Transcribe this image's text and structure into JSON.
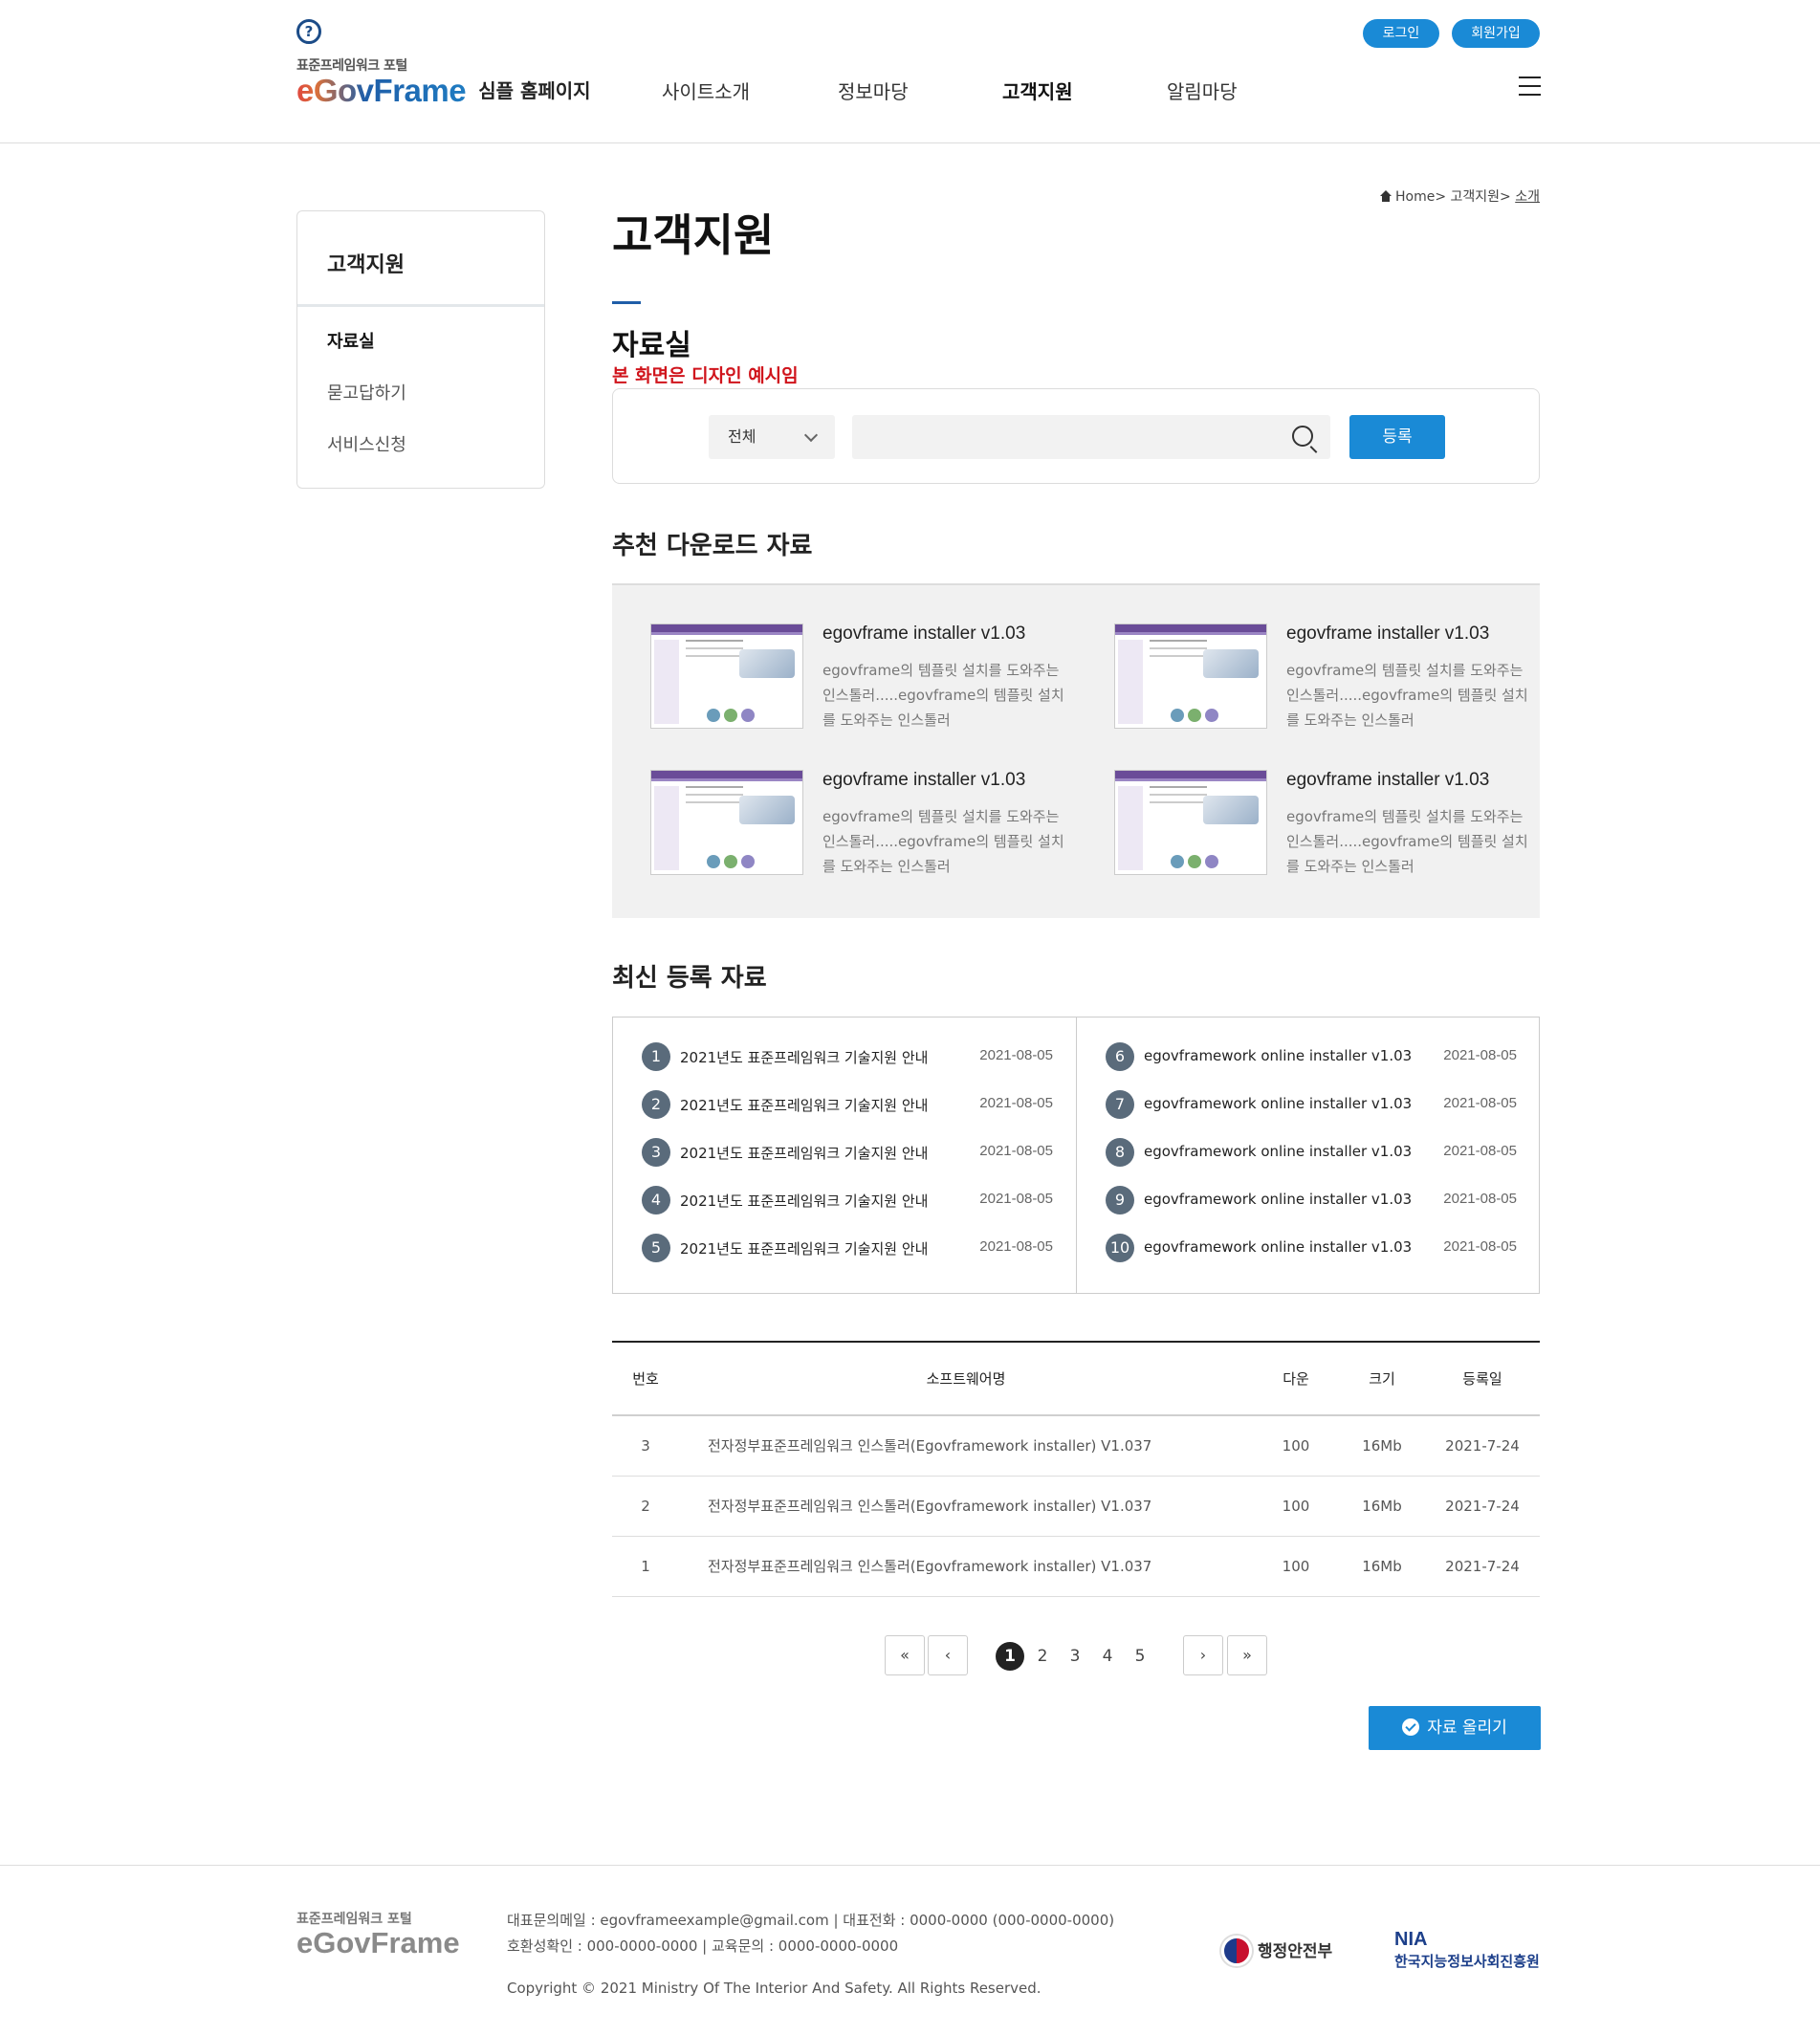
{
  "header": {
    "help_icon": "?",
    "logo_sub": "표준프레임워크 포털",
    "logo_main": "eGovFrame",
    "logo_tag": "심플 홈페이지",
    "nav": [
      "사이트소개",
      "정보마당",
      "고객지원",
      "알림마당"
    ],
    "nav_active": "고객지원",
    "login": "로그인",
    "signup": "회원가입"
  },
  "breadcrumb": {
    "home": "Home",
    "sep": ">",
    "level1": "고객지원",
    "level2": "소개"
  },
  "sidebar": {
    "title": "고객지원",
    "items": [
      {
        "label": "자료실",
        "active": true
      },
      {
        "label": "묻고답하기",
        "active": false
      },
      {
        "label": "서비스신청",
        "active": false
      }
    ]
  },
  "main": {
    "title": "고객지원",
    "subtitle": "자료실",
    "notice": "본 화면은 디자인 예시임"
  },
  "search": {
    "select_value": "전체",
    "input_value": "",
    "button": "등록"
  },
  "recommended": {
    "title": "추천 다운로드 자료",
    "items": [
      {
        "title": "egovframe installer v1.03",
        "desc": "egovframe의 템플릿 설치를 도와주는 인스톨러.....egovframe의 템플릿 설치를 도와주는 인스톨러"
      },
      {
        "title": "egovframe installer v1.03",
        "desc": "egovframe의 템플릿 설치를 도와주는 인스톨러.....egovframe의 템플릿 설치를 도와주는 인스톨러"
      },
      {
        "title": "egovframe installer v1.03",
        "desc": "egovframe의 템플릿 설치를 도와주는 인스톨러.....egovframe의 템플릿 설치를 도와주는 인스톨러"
      },
      {
        "title": "egovframe installer v1.03",
        "desc": "egovframe의 템플릿 설치를 도와주는 인스톨러.....egovframe의 템플릿 설치를 도와주는 인스톨러"
      }
    ]
  },
  "latest": {
    "title": "최신 등록 자료",
    "left": [
      {
        "no": "1",
        "title": "2021년도 표준프레임워크 기술지원 안내",
        "date": "2021-08-05"
      },
      {
        "no": "2",
        "title": "2021년도 표준프레임워크 기술지원 안내",
        "date": "2021-08-05"
      },
      {
        "no": "3",
        "title": "2021년도 표준프레임워크 기술지원 안내",
        "date": "2021-08-05"
      },
      {
        "no": "4",
        "title": "2021년도 표준프레임워크 기술지원 안내",
        "date": "2021-08-05"
      },
      {
        "no": "5",
        "title": "2021년도 표준프레임워크 기술지원 안내",
        "date": "2021-08-05"
      }
    ],
    "right": [
      {
        "no": "6",
        "title": "egovframework online installer v1.03",
        "date": "2021-08-05"
      },
      {
        "no": "7",
        "title": "egovframework online installer v1.03",
        "date": "2021-08-05"
      },
      {
        "no": "8",
        "title": "egovframework online installer v1.03",
        "date": "2021-08-05"
      },
      {
        "no": "9",
        "title": "egovframework online installer v1.03",
        "date": "2021-08-05"
      },
      {
        "no": "10",
        "title": "egovframework online installer v1.03",
        "date": "2021-08-05"
      }
    ]
  },
  "table": {
    "headers": [
      "번호",
      "소프트웨어명",
      "다운",
      "크기",
      "등록일"
    ],
    "rows": [
      [
        "3",
        "전자정부표준프레임워크 인스톨러(Egovframework installer) V1.037",
        "100",
        "16Mb",
        "2021-7-24"
      ],
      [
        "2",
        "전자정부표준프레임워크 인스톨러(Egovframework installer) V1.037",
        "100",
        "16Mb",
        "2021-7-24"
      ],
      [
        "1",
        "전자정부표준프레임워크 인스톨러(Egovframework installer) V1.037",
        "100",
        "16Mb",
        "2021-7-24"
      ]
    ]
  },
  "pagination": {
    "first": "«",
    "prev": "‹",
    "next": "›",
    "last": "»",
    "pages": [
      "1",
      "2",
      "3",
      "4",
      "5"
    ],
    "current": "1"
  },
  "upload_button": "자료 올리기",
  "footer": {
    "logo_sub": "표준프레임워크 포털",
    "logo_main": "eGovFrame",
    "info_line1": "대표문의메일 : egovframeexample@gmail.com | 대표전화 : 0000-0000 (000-0000-0000)",
    "info_line2": "호환성확인 : 000-0000-0000 | 교육문의 : 0000-0000-0000",
    "copyright": "Copyright © 2021 Ministry Of The Interior And Safety. All Rights Reserved.",
    "gov_logo": "행정안전부",
    "nia_big": "NIA",
    "nia_small": "한국지능정보사회진흥원"
  },
  "colors": {
    "primary": "#1a8ad6",
    "notice": "#d0141c",
    "brand_blue": "#1f5ea8"
  }
}
